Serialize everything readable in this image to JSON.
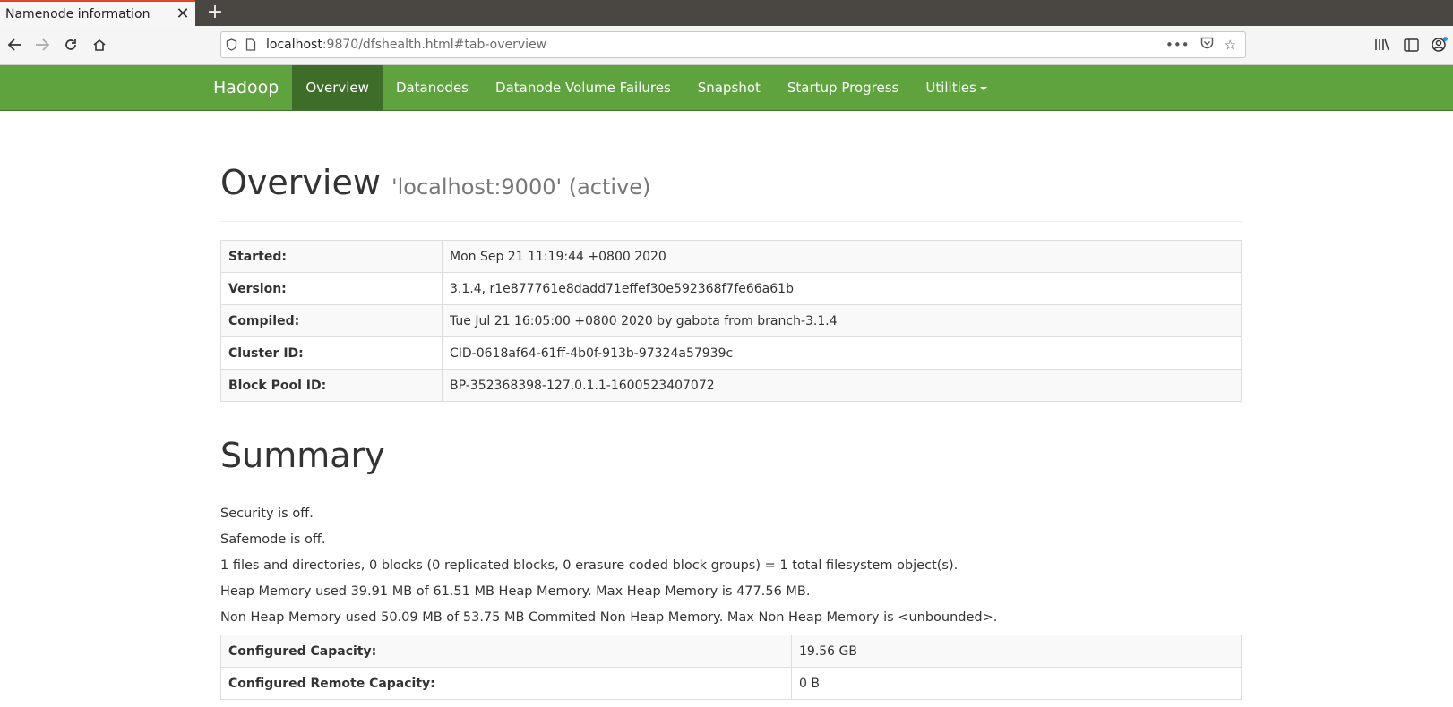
{
  "browser": {
    "tab_title": "Namenode information",
    "url_host": "localhost",
    "url_rest": ":9870/dfshealth.html#tab-overview"
  },
  "hadoop_nav": {
    "brand": "Hadoop",
    "items": [
      "Overview",
      "Datanodes",
      "Datanode Volume Failures",
      "Snapshot",
      "Startup Progress",
      "Utilities"
    ],
    "active": "Overview",
    "accent_color": "#5fa33e"
  },
  "overview": {
    "title": "Overview",
    "subtitle": "'localhost:9000' (active)",
    "rows": [
      {
        "key": "Started:",
        "value": "Mon Sep 21 11:19:44 +0800 2020"
      },
      {
        "key": "Version:",
        "value": "3.1.4, r1e877761e8dadd71effef30e592368f7fe66a61b"
      },
      {
        "key": "Compiled:",
        "value": "Tue Jul 21 16:05:00 +0800 2020 by gabota from branch-3.1.4"
      },
      {
        "key": "Cluster ID:",
        "value": "CID-0618af64-61ff-4b0f-913b-97324a57939c"
      },
      {
        "key": "Block Pool ID:",
        "value": "BP-352368398-127.0.1.1-1600523407072"
      }
    ]
  },
  "summary": {
    "title": "Summary",
    "lines": [
      "Security is off.",
      "Safemode is off.",
      "1 files and directories, 0 blocks (0 replicated blocks, 0 erasure coded block groups) = 1 total filesystem object(s).",
      "Heap Memory used 39.91 MB of 61.51 MB Heap Memory. Max Heap Memory is 477.56 MB.",
      "Non Heap Memory used 50.09 MB of 53.75 MB Commited Non Heap Memory. Max Non Heap Memory is <unbounded>."
    ],
    "capacity_rows": [
      {
        "key": "Configured Capacity:",
        "value": "19.56 GB"
      },
      {
        "key": "Configured Remote Capacity:",
        "value": "0 B"
      }
    ]
  }
}
